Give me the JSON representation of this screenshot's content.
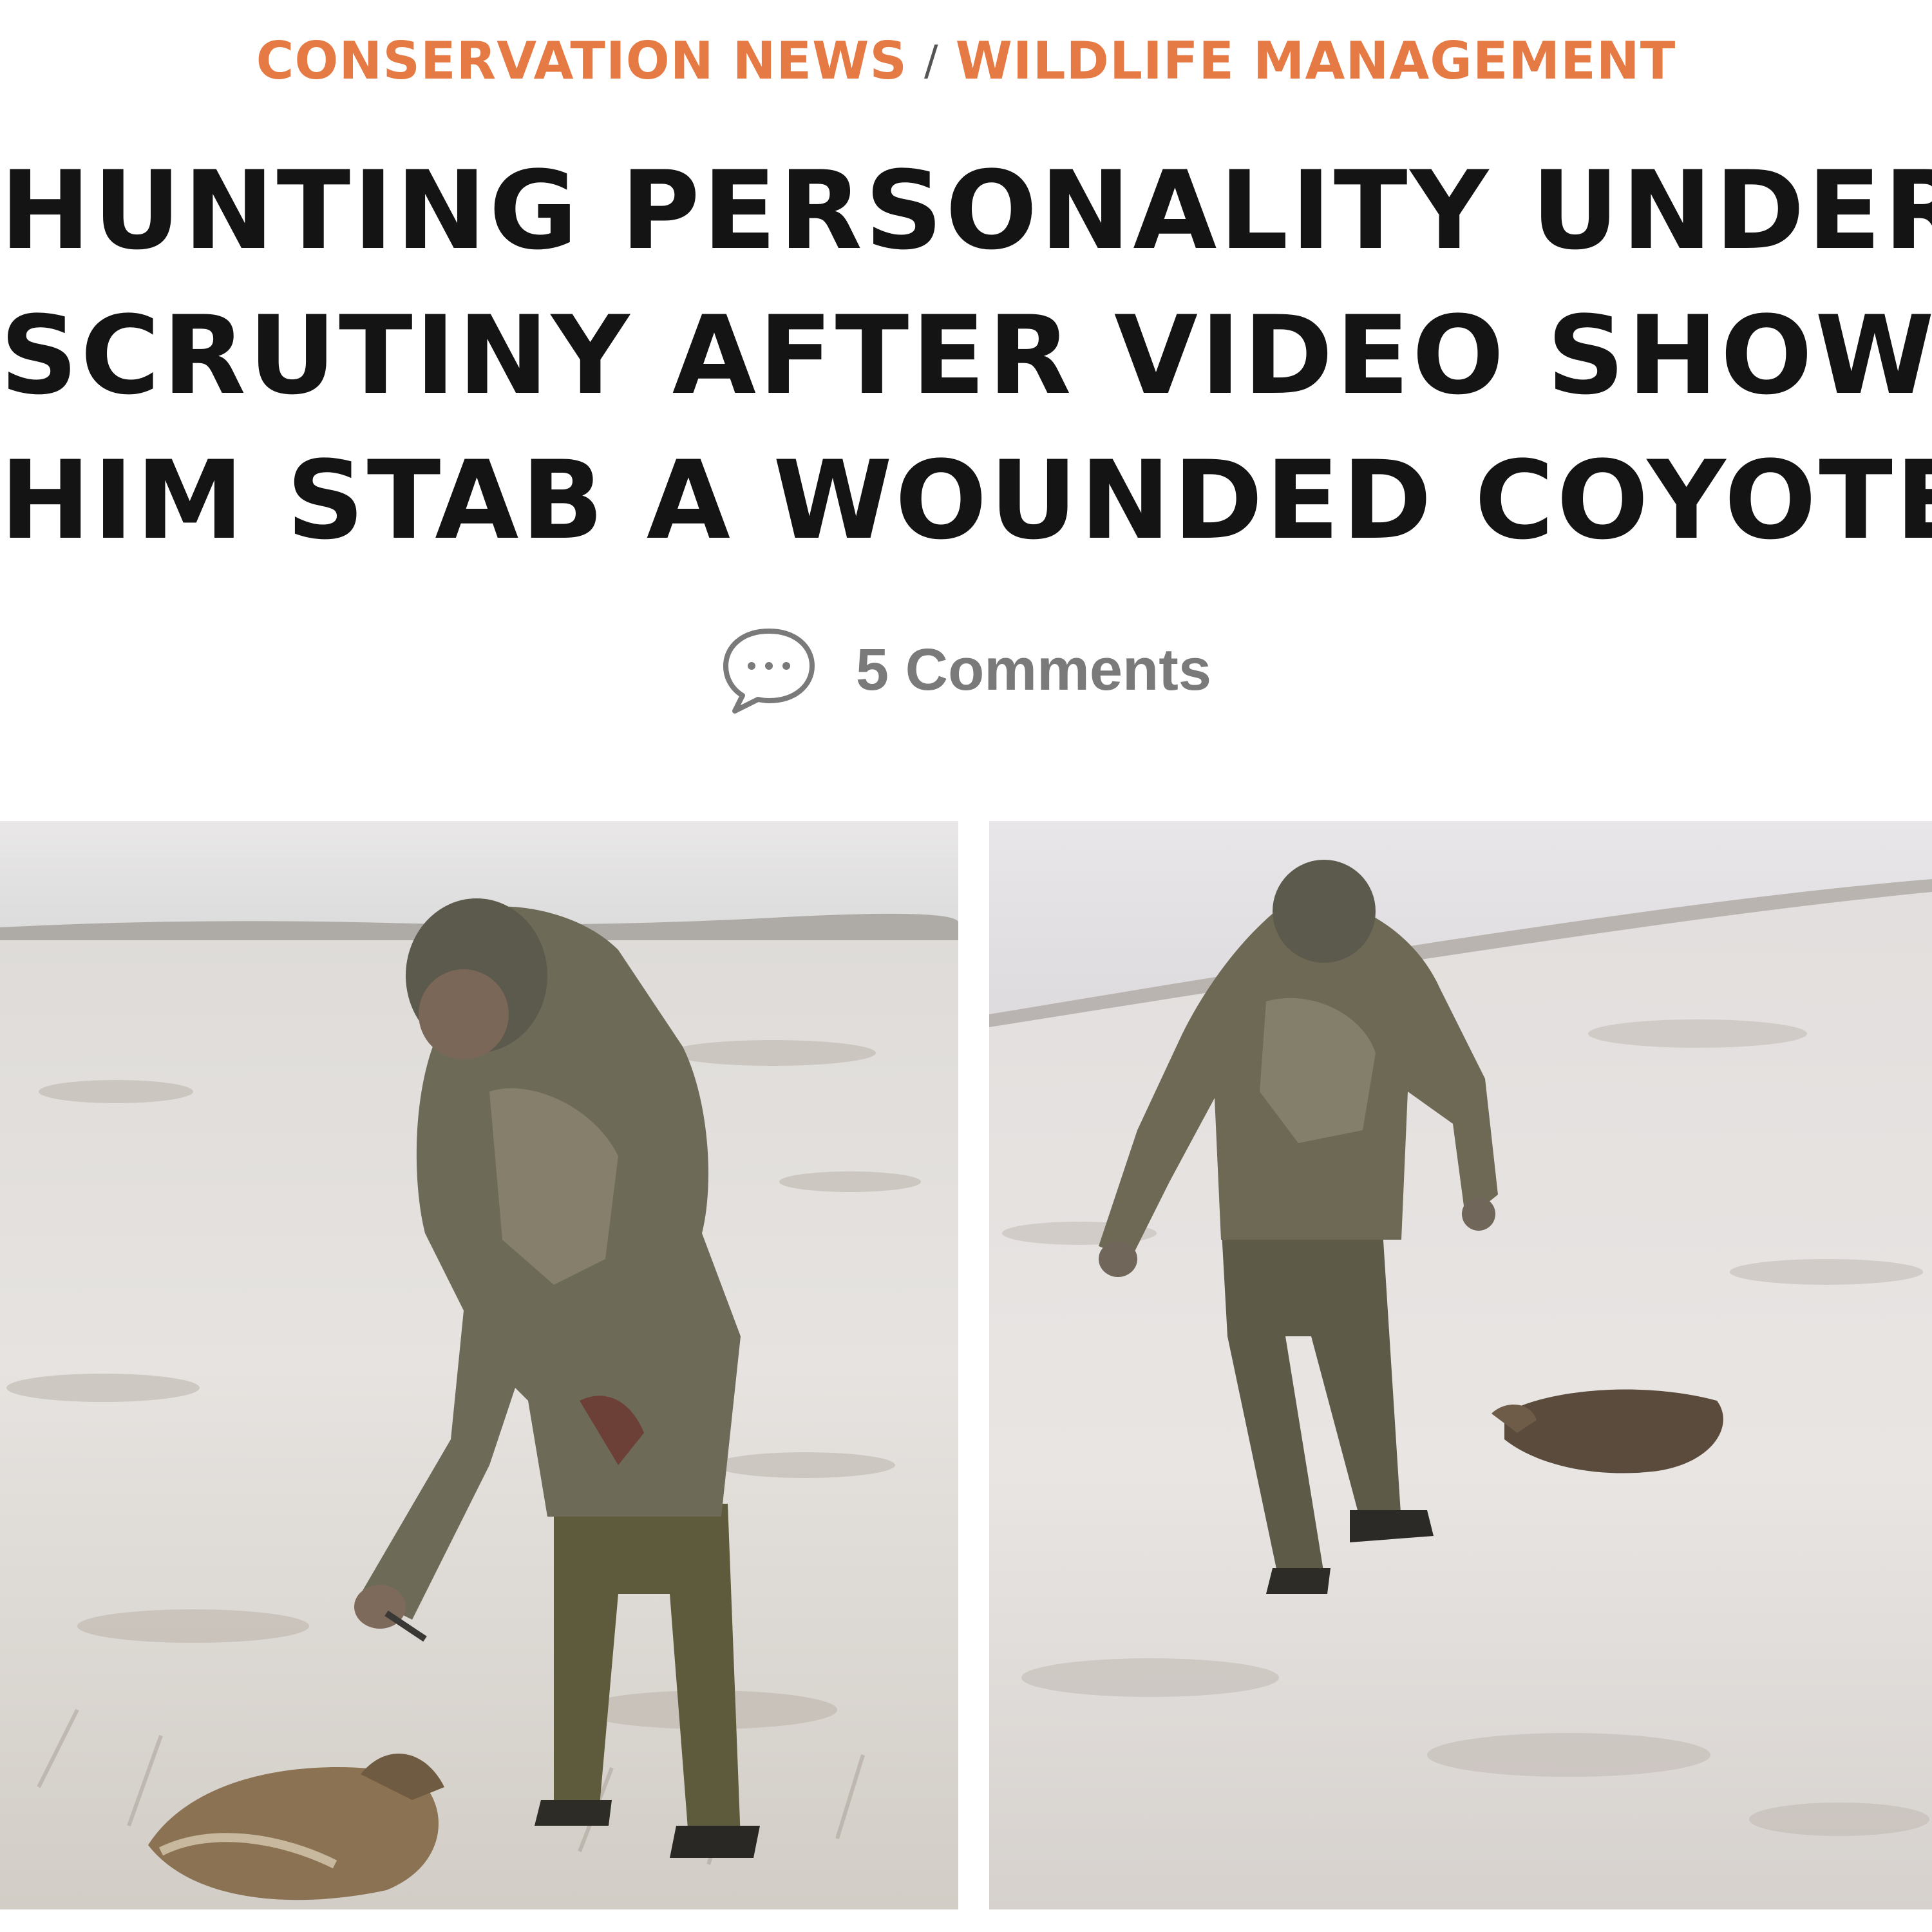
{
  "breadcrumb": {
    "category": "CONSERVATION NEWS",
    "separator": "/",
    "subcategory": "WILDLIFE MANAGEMENT"
  },
  "article": {
    "headline_lines": [
      "HUNTING PERSONALITY UNDER",
      "SCRUTINY AFTER VIDEO SHOWS",
      "HIM STAB A WOUNDED COYOTE"
    ],
    "comments_label": "5 Comments"
  },
  "icons": {
    "comments": "speech-bubble-icon"
  },
  "colors": {
    "breadcrumb": "#e67a45",
    "headline": "#141414",
    "comments_text": "#7a7a7a",
    "comment_icon_stroke": "#7a7a7a"
  }
}
